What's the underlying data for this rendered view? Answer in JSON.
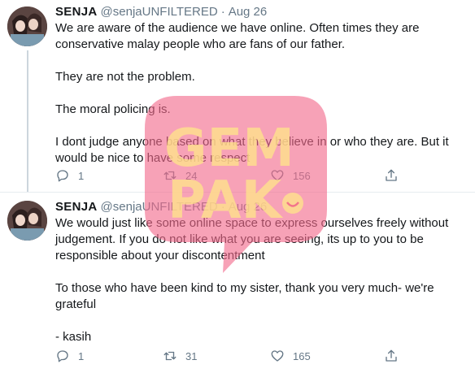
{
  "tweets": [
    {
      "name": "SENJA",
      "handle": "@senjaUNFILTERED",
      "separator": "·",
      "date": "Aug 26",
      "paragraphs": [
        "We are aware of the audience we have online. Often times they are conservative malay people who are fans of our father.",
        "They are not the problem.",
        "The moral policing is.",
        "I dont judge anyone based on what they believe in or who they are. But it would be nice to have some respect"
      ],
      "replies": "1",
      "retweets": "24",
      "likes": "156"
    },
    {
      "name": "SENJA",
      "handle": "@senjaUNFILTERED",
      "separator": "·",
      "date": "Aug 26",
      "paragraphs": [
        "We would just like some online space to express ourselves freely without judgement. If you do not like what you are seeing, its up to you to be responsible about your discontentment",
        "To those who have been kind to my sister, thank you very much- we're grateful",
        "- kasih"
      ],
      "replies": "1",
      "retweets": "31",
      "likes": "165"
    }
  ],
  "icons": {
    "reply": "speech-bubble",
    "retweet": "retweet-arrows",
    "like": "heart",
    "share": "upload-arrow"
  },
  "watermark": {
    "line1": "GEM",
    "line2": "PAK"
  },
  "colors": {
    "text": "#14171a",
    "secondary": "#657786",
    "divider": "#e6ecf0",
    "thread": "#ccd6dd",
    "watermark_pink": "#f2698a",
    "watermark_yellow": "#ffe38a"
  }
}
